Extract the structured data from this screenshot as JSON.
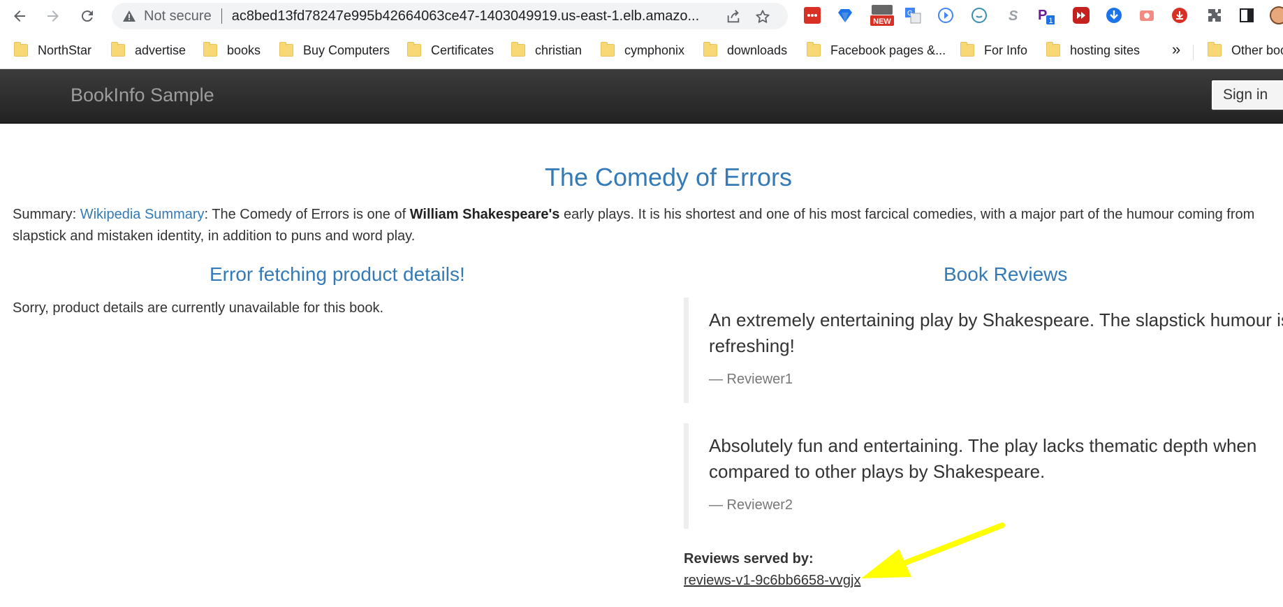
{
  "browser": {
    "security_label": "Not secure",
    "url": "ac8bed13fd78247e995b42664063ce47-1403049919.us-east-1.elb.amazo...",
    "extensions": {
      "new_badge": "NEW",
      "badge_count": "1"
    },
    "bookmarks": [
      {
        "label": "NorthStar"
      },
      {
        "label": "advertise"
      },
      {
        "label": "books"
      },
      {
        "label": "Buy Computers"
      },
      {
        "label": "Certificates"
      },
      {
        "label": "christian"
      },
      {
        "label": "cymphonix"
      },
      {
        "label": "downloads"
      },
      {
        "label": "Facebook pages &..."
      },
      {
        "label": "For Info"
      },
      {
        "label": "hosting sites"
      }
    ],
    "more_bookmarks": "»",
    "other_bookmarks": "Other boo"
  },
  "navbar": {
    "brand": "BookInfo Sample",
    "signin_label": "Sign in"
  },
  "product": {
    "title": "The Comedy of Errors",
    "summary_prefix": "Summary: ",
    "summary_link": "Wikipedia Summary",
    "summary_text_1": ": The Comedy of Errors is one of ",
    "summary_bold": "William Shakespeare's",
    "summary_text_2": " early plays. It is his shortest and one of his most farcical comedies, with a major part of the humour coming from slapstick and mistaken identity, in addition to puns and word play."
  },
  "details": {
    "heading": "Error fetching product details!",
    "message": "Sorry, product details are currently unavailable for this book."
  },
  "reviews": {
    "heading": "Book Reviews",
    "items": [
      {
        "text": "An extremely entertaining play by Shakespeare. The slapstick humour is refreshing!",
        "author": "— Reviewer1"
      },
      {
        "text": "Absolutely fun and entertaining. The play lacks thematic depth when compared to other plays by Shakespeare.",
        "author": "— Reviewer2"
      }
    ],
    "served_by_label": "Reviews served by:",
    "served_by_value": "reviews-v1-9c6bb6658-vvgjx"
  },
  "colors": {
    "link_blue": "#337ab7",
    "navbar_dark": "#222222",
    "annotation_arrow": "#ffff00"
  }
}
